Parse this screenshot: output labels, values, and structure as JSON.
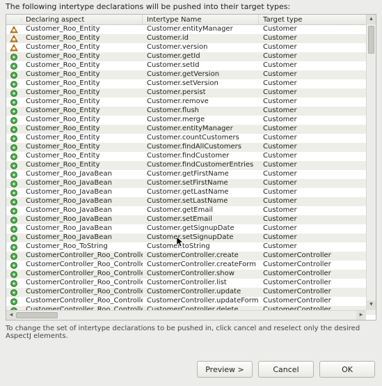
{
  "instruction": "The following intertype declarations will be pushed into their target types:",
  "columns": {
    "declaring": "Declaring aspect",
    "intertype": "Intertype Name",
    "target": "Target type"
  },
  "hint": "To change the set of intertype declarations to be pushed in, click cancel and reselect only the desired AspectJ elements.",
  "buttons": {
    "preview": "Preview >",
    "cancel": "Cancel",
    "ok": "OK"
  },
  "rows": [
    {
      "icon": "field",
      "da": "Customer_Roo_Entity",
      "in": "Customer.entityManager",
      "tt": "Customer"
    },
    {
      "icon": "field",
      "da": "Customer_Roo_Entity",
      "in": "Customer.id",
      "tt": "Customer"
    },
    {
      "icon": "field",
      "da": "Customer_Roo_Entity",
      "in": "Customer.version",
      "tt": "Customer"
    },
    {
      "icon": "method",
      "da": "Customer_Roo_Entity",
      "in": "Customer.getId",
      "tt": "Customer"
    },
    {
      "icon": "method",
      "da": "Customer_Roo_Entity",
      "in": "Customer.setId",
      "tt": "Customer"
    },
    {
      "icon": "method",
      "da": "Customer_Roo_Entity",
      "in": "Customer.getVersion",
      "tt": "Customer"
    },
    {
      "icon": "method",
      "da": "Customer_Roo_Entity",
      "in": "Customer.setVersion",
      "tt": "Customer"
    },
    {
      "icon": "method",
      "da": "Customer_Roo_Entity",
      "in": "Customer.persist",
      "tt": "Customer"
    },
    {
      "icon": "method",
      "da": "Customer_Roo_Entity",
      "in": "Customer.remove",
      "tt": "Customer"
    },
    {
      "icon": "method",
      "da": "Customer_Roo_Entity",
      "in": "Customer.flush",
      "tt": "Customer"
    },
    {
      "icon": "method",
      "da": "Customer_Roo_Entity",
      "in": "Customer.merge",
      "tt": "Customer"
    },
    {
      "icon": "method",
      "da": "Customer_Roo_Entity",
      "in": "Customer.entityManager",
      "tt": "Customer"
    },
    {
      "icon": "method",
      "da": "Customer_Roo_Entity",
      "in": "Customer.countCustomers",
      "tt": "Customer"
    },
    {
      "icon": "method",
      "da": "Customer_Roo_Entity",
      "in": "Customer.findAllCustomers",
      "tt": "Customer"
    },
    {
      "icon": "method",
      "da": "Customer_Roo_Entity",
      "in": "Customer.findCustomer",
      "tt": "Customer"
    },
    {
      "icon": "method",
      "da": "Customer_Roo_Entity",
      "in": "Customer.findCustomerEntries",
      "tt": "Customer"
    },
    {
      "icon": "method",
      "da": "Customer_Roo_JavaBean",
      "in": "Customer.getFirstName",
      "tt": "Customer"
    },
    {
      "icon": "method",
      "da": "Customer_Roo_JavaBean",
      "in": "Customer.setFirstName",
      "tt": "Customer"
    },
    {
      "icon": "method",
      "da": "Customer_Roo_JavaBean",
      "in": "Customer.getLastName",
      "tt": "Customer"
    },
    {
      "icon": "method",
      "da": "Customer_Roo_JavaBean",
      "in": "Customer.setLastName",
      "tt": "Customer"
    },
    {
      "icon": "method",
      "da": "Customer_Roo_JavaBean",
      "in": "Customer.getEmail",
      "tt": "Customer"
    },
    {
      "icon": "method",
      "da": "Customer_Roo_JavaBean",
      "in": "Customer.setEmail",
      "tt": "Customer"
    },
    {
      "icon": "method",
      "da": "Customer_Roo_JavaBean",
      "in": "Customer.getSignupDate",
      "tt": "Customer"
    },
    {
      "icon": "method",
      "da": "Customer_Roo_JavaBean",
      "in": "Customer.setSignupDate",
      "tt": "Customer"
    },
    {
      "icon": "method",
      "da": "Customer_Roo_ToString",
      "in": "Customer.toString",
      "tt": "Customer"
    },
    {
      "icon": "method",
      "da": "CustomerController_Roo_Controller",
      "in": "CustomerController.create",
      "tt": "CustomerController"
    },
    {
      "icon": "method",
      "da": "CustomerController_Roo_Controller",
      "in": "CustomerController.createForm",
      "tt": "CustomerController"
    },
    {
      "icon": "method",
      "da": "CustomerController_Roo_Controller",
      "in": "CustomerController.show",
      "tt": "CustomerController"
    },
    {
      "icon": "method",
      "da": "CustomerController_Roo_Controller",
      "in": "CustomerController.list",
      "tt": "CustomerController"
    },
    {
      "icon": "method",
      "da": "CustomerController_Roo_Controller",
      "in": "CustomerController.update",
      "tt": "CustomerController"
    },
    {
      "icon": "method",
      "da": "CustomerController_Roo_Controller",
      "in": "CustomerController.updateForm",
      "tt": "CustomerController"
    },
    {
      "icon": "method",
      "da": "CustomerController_Roo_Controller",
      "in": "CustomerController.delete",
      "tt": "CustomerController"
    }
  ]
}
